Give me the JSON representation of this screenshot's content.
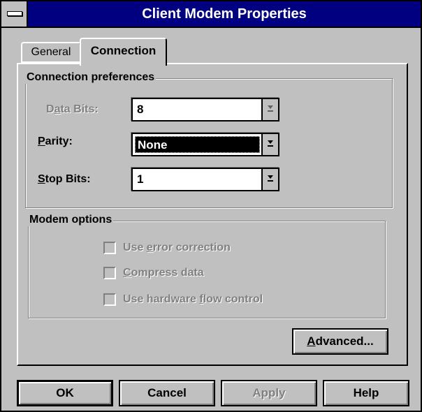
{
  "window": {
    "title": "Client Modem Properties"
  },
  "tabs": [
    {
      "label": "General",
      "active": false
    },
    {
      "label": "Connection",
      "active": true
    }
  ],
  "connection_preferences": {
    "legend": "Connection preferences",
    "fields": [
      {
        "label_pre": "D",
        "label_mnemonic": "a",
        "label_post": "ta Bits:",
        "value": "8",
        "enabled": false
      },
      {
        "label_pre": "",
        "label_mnemonic": "P",
        "label_post": "arity:",
        "value": "None",
        "enabled": true,
        "focused": true
      },
      {
        "label_pre": "",
        "label_mnemonic": "S",
        "label_post": "top Bits:",
        "value": "1",
        "enabled": true
      }
    ]
  },
  "modem_options": {
    "legend": "Modem options",
    "checkboxes": [
      {
        "label_pre": "Use ",
        "label_mnemonic": "e",
        "label_post": "rror correction",
        "checked": false,
        "enabled": false
      },
      {
        "label_pre": "",
        "label_mnemonic": "C",
        "label_post": "ompress data",
        "checked": false,
        "enabled": false
      },
      {
        "label_pre": "Use hardware ",
        "label_mnemonic": "f",
        "label_post": "low control",
        "checked": false,
        "enabled": false
      }
    ]
  },
  "advanced_button": {
    "label_mnemonic": "A",
    "label_post": "dvanced..."
  },
  "buttons": {
    "ok": "OK",
    "cancel": "Cancel",
    "apply": "Apply",
    "help": "Help"
  },
  "colors": {
    "title_bar": "#000080",
    "face": "#c0c0c0",
    "disabled_text": "#808080"
  }
}
